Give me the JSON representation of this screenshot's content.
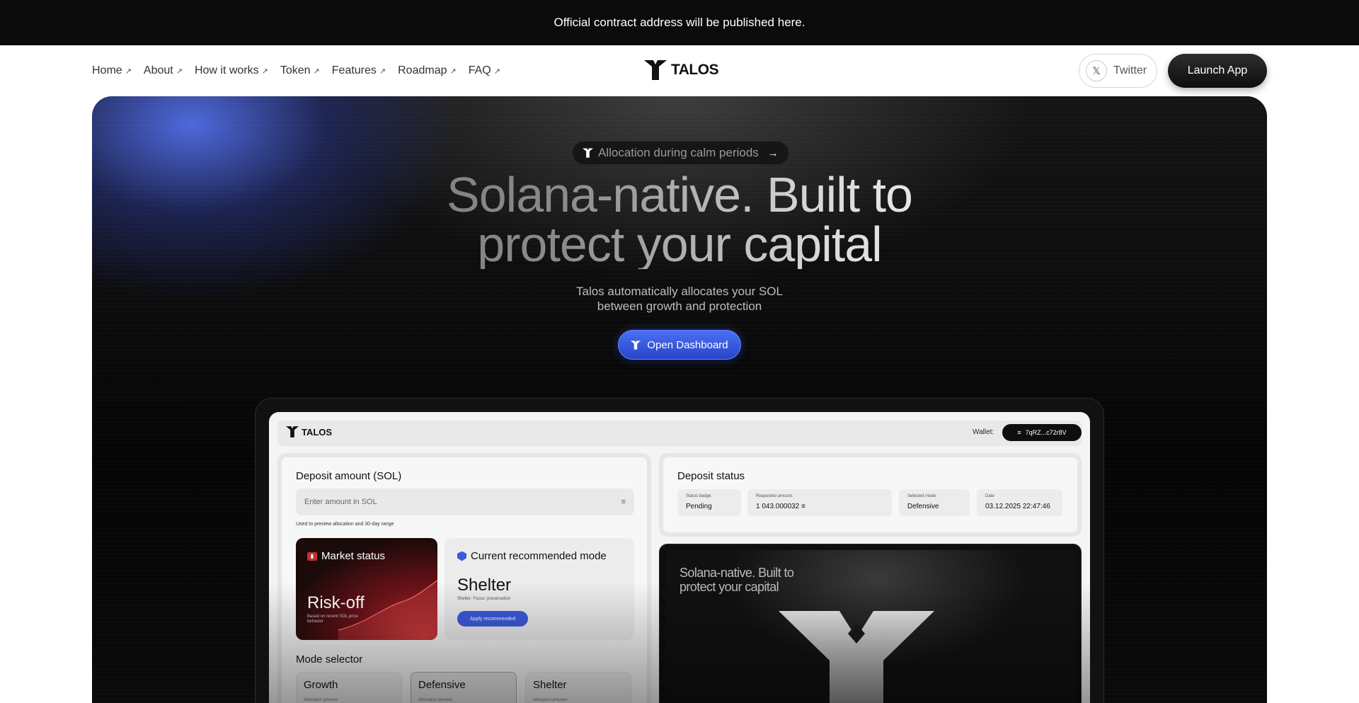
{
  "announcement": {
    "text": "Official contract address will be published here."
  },
  "nav": {
    "links": [
      {
        "label": "Home",
        "arrow": "↗"
      },
      {
        "label": "About",
        "arrow": "↗"
      },
      {
        "label": "How it works",
        "arrow": "↗"
      },
      {
        "label": "Token",
        "arrow": "↗"
      },
      {
        "label": "Features",
        "arrow": "↗"
      },
      {
        "label": "Roadmap",
        "arrow": "↗"
      },
      {
        "label": "FAQ",
        "arrow": "↗"
      }
    ],
    "brand": "TALOS",
    "twitter_label": "Twitter",
    "twitter_icon": "𝕏",
    "launch_label": "Launch App"
  },
  "hero": {
    "pill_label": "Allocation during calm periods",
    "pill_arrow": "→",
    "headline_line1": "Solana-native. Built to",
    "headline_line2": "protect your capital",
    "subtitle_line1": "Talos automatically allocates your SOL",
    "subtitle_line2": "between growth and protection",
    "cta_label": "Open Dashboard",
    "accent_color": "#3b5bdb"
  },
  "dashboard": {
    "brand": "TALOS",
    "wallet_label": "Wallet:",
    "wallet_address": "7qRZ...c72r8V",
    "deposit": {
      "title": "Deposit amount (SOL)",
      "placeholder": "Enter amount in SOL",
      "hint": "Used to preview allocation and 30-day range"
    },
    "market": {
      "title": "Market status",
      "value": "Risk-off",
      "note": "Based on recent SOL price behavior"
    },
    "recommended": {
      "title": "Current recommended mode",
      "value": "Shelter",
      "note": "Shelter: Focus: preservation",
      "apply_label": "Apply recommended"
    },
    "mode_selector": {
      "title": "Mode selector",
      "options": [
        {
          "label": "Growth",
          "note": "Allocation preview"
        },
        {
          "label": "Defensive",
          "note": "Allocation preview"
        },
        {
          "label": "Shelter",
          "note": "Allocation preview"
        }
      ]
    },
    "status": {
      "title": "Deposit status",
      "items": [
        {
          "key": "Status badge:",
          "value": "Pending"
        },
        {
          "key": "Requested amount:",
          "value": "1 043.000032"
        },
        {
          "key": "Selected mode:",
          "value": "Defensive"
        },
        {
          "key": "Date",
          "value": "03.12.2025 22:47:46"
        }
      ]
    },
    "promo": {
      "line1": "Solana-native. Built to",
      "line2": "protect your capital"
    }
  }
}
